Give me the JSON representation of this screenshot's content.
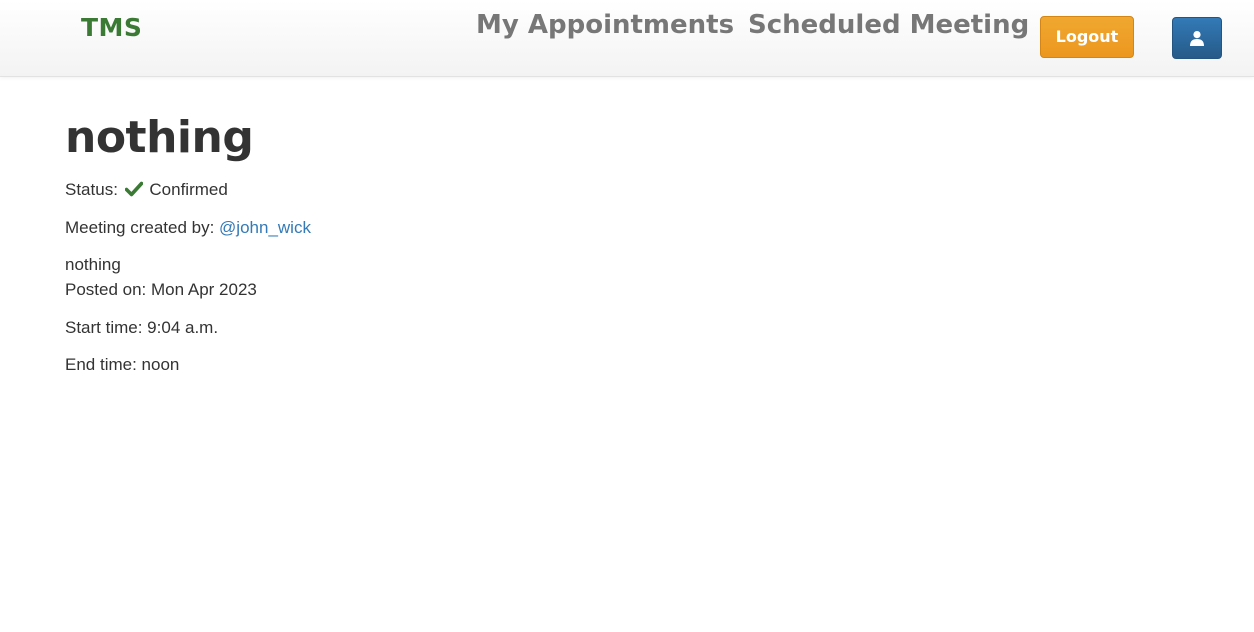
{
  "navbar": {
    "brand": "TMS",
    "links": [
      {
        "label": "My Appointments"
      },
      {
        "label": "Scheduled Meeting"
      }
    ],
    "logout_label": "Logout",
    "user_icon": "user-icon"
  },
  "meeting": {
    "title": "nothing",
    "status_label": "Status:",
    "status_icon": "check-icon",
    "status_value": "Confirmed",
    "created_by_label": "Meeting created by:",
    "created_by_user": "@john_wick",
    "description": "nothing",
    "posted_on": "Posted on: Mon Apr 2023",
    "start_time": "Start time: 9:04 a.m.",
    "end_time": "End time: noon"
  },
  "colors": {
    "brand": "#3a7a34",
    "logout": "#ec971f",
    "user_button": "#2e6da4",
    "link": "#337ab7",
    "check": "#3a7a34"
  }
}
